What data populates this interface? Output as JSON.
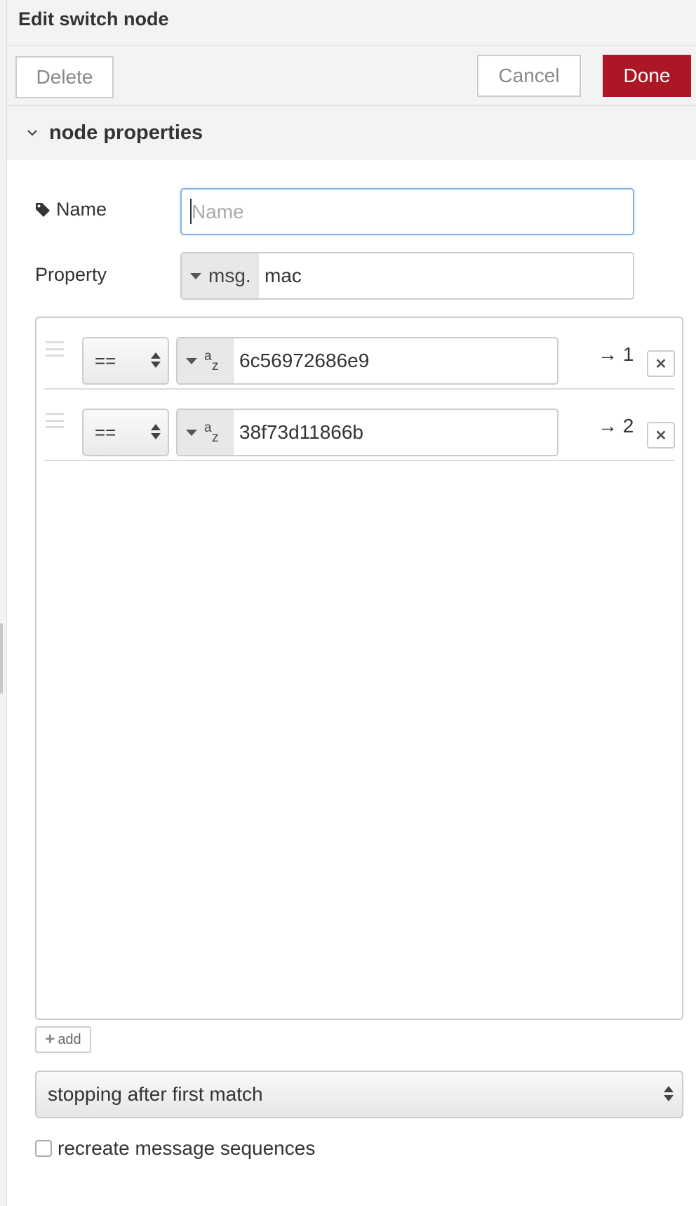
{
  "header": {
    "title": "Edit switch node"
  },
  "toolbar": {
    "delete_label": "Delete",
    "cancel_label": "Cancel",
    "done_label": "Done"
  },
  "section": {
    "title": "node properties"
  },
  "form": {
    "name_label": "Name",
    "name_placeholder": "Name",
    "name_value": "",
    "property_label": "Property",
    "property_prefix": "msg.",
    "property_value": "mac"
  },
  "rules": [
    {
      "operator": "==",
      "value_type": "string",
      "value": "6c56972686e9",
      "output": "→ 1"
    },
    {
      "operator": "==",
      "value_type": "string",
      "value": "38f73d11866b",
      "output": "→ 2"
    }
  ],
  "add_label": "add",
  "mode": {
    "selected": "stopping after first match"
  },
  "recreate": {
    "label": "recreate message sequences",
    "checked": false
  },
  "colors": {
    "done_bg": "#ad1625",
    "focus_border": "#85b2e0"
  }
}
